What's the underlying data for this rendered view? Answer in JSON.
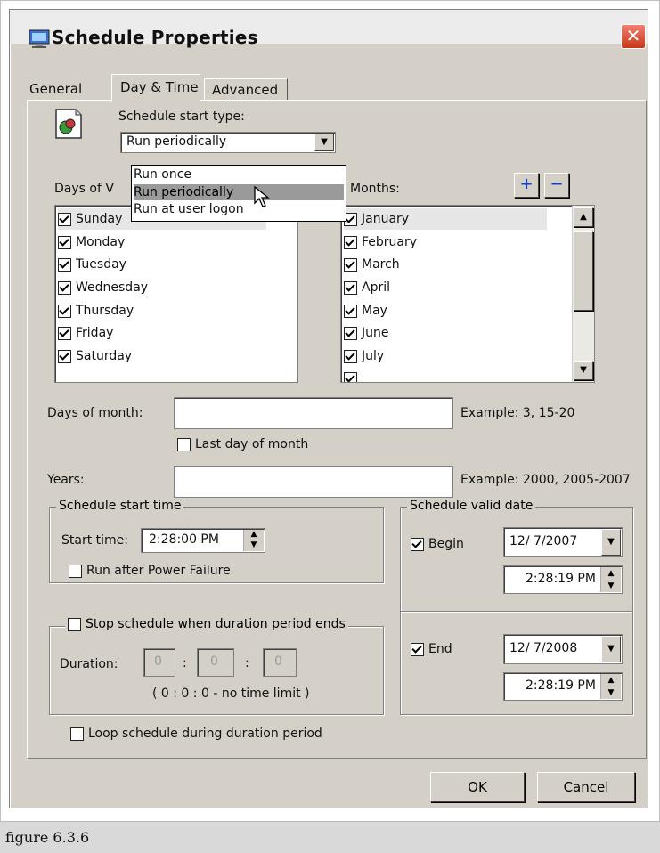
{
  "window": {
    "title": "Schedule Properties",
    "close_glyph": "✕"
  },
  "tabs": [
    {
      "label": "General"
    },
    {
      "label": "Day & Time"
    },
    {
      "label": "Advanced"
    }
  ],
  "start_type": {
    "label": "Schedule start type:",
    "value": "Run periodically",
    "options": [
      "Run once",
      "Run periodically",
      "Run at user logon"
    ]
  },
  "days_of_week": {
    "label": "Days of V",
    "items": [
      "Sunday",
      "Monday",
      "Tuesday",
      "Wednesday",
      "Thursday",
      "Friday",
      "Saturday"
    ]
  },
  "months": {
    "label": "Months:",
    "plus": "+",
    "minus": "−",
    "items": [
      "January",
      "February",
      "March",
      "April",
      "May",
      "June",
      "July"
    ]
  },
  "days_of_month": {
    "label": "Days of month:",
    "value": "",
    "example": "Example: 3, 15-20"
  },
  "last_day": {
    "label": "Last day of month"
  },
  "years": {
    "label": "Years:",
    "value": "",
    "example": "Example: 2000, 2005-2007"
  },
  "start_time_group": {
    "title": "Schedule start time",
    "start_label": "Start time:",
    "start_value": "2:28:00 PM",
    "power_failure": "Run after Power Failure"
  },
  "duration_group": {
    "title": "Stop schedule when duration period ends",
    "duration_label": "Duration:",
    "values": [
      "0",
      "0",
      "0"
    ],
    "sep": ":",
    "note": "( 0 : 0 : 0 - no time limit )"
  },
  "valid_date": {
    "title": "Schedule valid date",
    "begin_label": "Begin",
    "begin_date": "12/ 7/2007",
    "begin_time": "2:28:19 PM",
    "end_label": "End",
    "end_date": "12/ 7/2008",
    "end_time": "2:28:19 PM"
  },
  "loop": {
    "label": "Loop schedule during duration period"
  },
  "buttons": {
    "ok": "OK",
    "cancel": "Cancel"
  },
  "caption": "figure 6.3.6"
}
